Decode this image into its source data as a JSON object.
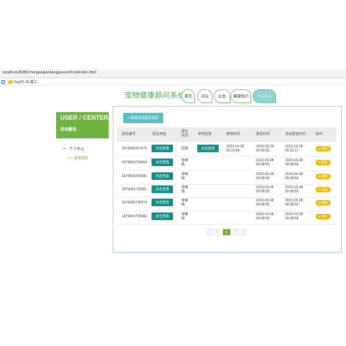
{
  "browser": {
    "url": "localhost:8080/chongwujiankangguwen/front/index.html",
    "bookmark": "Day02-JS-基工..."
  },
  "site": {
    "title": "宠物健康顾问系统",
    "nav": [
      {
        "label": "首页"
      },
      {
        "label": "论坛"
      },
      {
        "label": "公告"
      },
      {
        "label": "健康知识"
      },
      {
        "label": "个人中心",
        "active": true
      }
    ]
  },
  "sidebar": {
    "title": "USER / CENTER",
    "subtitle": "活动报名",
    "items": [
      {
        "label": "个人中心"
      },
      {
        "label": "—— 报名报告"
      }
    ]
  },
  "toolbar": {
    "add_label": "+ 新增活动报名信息"
  },
  "table": {
    "headers": [
      "报名编号",
      "报名用途",
      "报名\n状态",
      "审核回复",
      "审核时间",
      "报名时间",
      "活动报名时间",
      "操作"
    ],
    "rows": [
      {
        "id": "1679666507975",
        "view_label": "点击查看",
        "status": "同意",
        "reply_btn": "点击查看",
        "audit_time": "2023-03-28\n09:23:45",
        "report_time": "2023-03-28\n00:00:00",
        "create_time": "2023-03-28\n09:23:17",
        "op": "● 修改"
      },
      {
        "id": "1679665735964",
        "view_label": "点击查看",
        "status": "待审\n核",
        "reply_btn": "",
        "audit_time": "",
        "report_time": "2023-03-28\n09:08:55",
        "create_time": "2023-03-28\n09:08:55",
        "op": "● 修改"
      },
      {
        "id": "1679665735985",
        "view_label": "点击查看",
        "status": "待审\n核",
        "reply_btn": "",
        "audit_time": "",
        "report_time": "2023-03-28\n09:08:55",
        "create_time": "2023-03-28\n09:08:55",
        "op": "● 修改"
      },
      {
        "id": "1679665735981",
        "view_label": "点击查看",
        "status": "待审\n核",
        "reply_btn": "",
        "audit_time": "",
        "report_time": "2023-03-28\n09:08:55",
        "create_time": "2023-03-28\n09:08:55",
        "op": "● 修改"
      },
      {
        "id": "1679665735974",
        "view_label": "点击查看",
        "status": "待审\n核",
        "reply_btn": "",
        "audit_time": "",
        "report_time": "2023-03-28\n09:08:55",
        "create_time": "2023-03-28\n09:08:55",
        "op": "● 修改"
      },
      {
        "id": "1679665735966",
        "view_label": "点击查看",
        "status": "待审\n核",
        "reply_btn": "",
        "audit_time": "",
        "report_time": "2023-03-28\n09:08:55",
        "create_time": "2023-03-28\n09:08:55",
        "op": "● 修改"
      }
    ]
  },
  "pagination": {
    "prev": "上一页",
    "current": "1",
    "next": "下一页"
  },
  "colors": {
    "accent_green": "#6fb43f",
    "teal_button": "#0e8f88",
    "op_yellow": "#f5b90f",
    "panel_border": "#9fd7e2"
  }
}
